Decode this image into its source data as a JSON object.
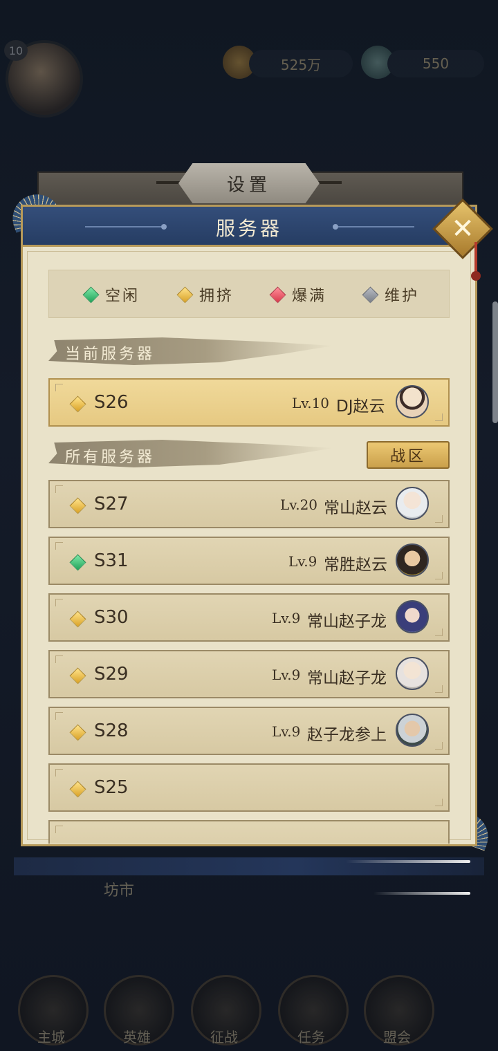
{
  "background": {
    "player_level": "10",
    "currency_1": "525万",
    "currency_2": "550",
    "faded_tab": "坊市",
    "nav": [
      "主城",
      "英雄",
      "征战",
      "任务",
      "盟会"
    ]
  },
  "settings_tab": {
    "label": "设置"
  },
  "dialog": {
    "title": "服务器",
    "close_label": "✕"
  },
  "legend": [
    {
      "label": "空闲",
      "color": "#2fbf6a"
    },
    {
      "label": "拥挤",
      "color": "#e8b53a"
    },
    {
      "label": "爆满",
      "color": "#e04a5a"
    },
    {
      "label": "维护",
      "color": "#8a8f98"
    }
  ],
  "current_section": {
    "label": "当前服务器",
    "server": {
      "id": "S26",
      "level": "Lv.10",
      "player": "DJ赵云",
      "status": "拥挤"
    }
  },
  "all_section": {
    "label": "所有服务器",
    "zone_button": "战区",
    "servers": [
      {
        "id": "S27",
        "level": "Lv.20",
        "player": "常山赵云",
        "status": "拥挤"
      },
      {
        "id": "S31",
        "level": "Lv.9",
        "player": "常胜赵云",
        "status": "空闲"
      },
      {
        "id": "S30",
        "level": "Lv.9",
        "player": "常山赵子龙",
        "status": "拥挤"
      },
      {
        "id": "S29",
        "level": "Lv.9",
        "player": "常山赵子龙",
        "status": "拥挤"
      },
      {
        "id": "S28",
        "level": "Lv.9",
        "player": "赵子龙参上",
        "status": "拥挤"
      },
      {
        "id": "S25",
        "level": "",
        "player": "",
        "status": "拥挤"
      }
    ]
  }
}
